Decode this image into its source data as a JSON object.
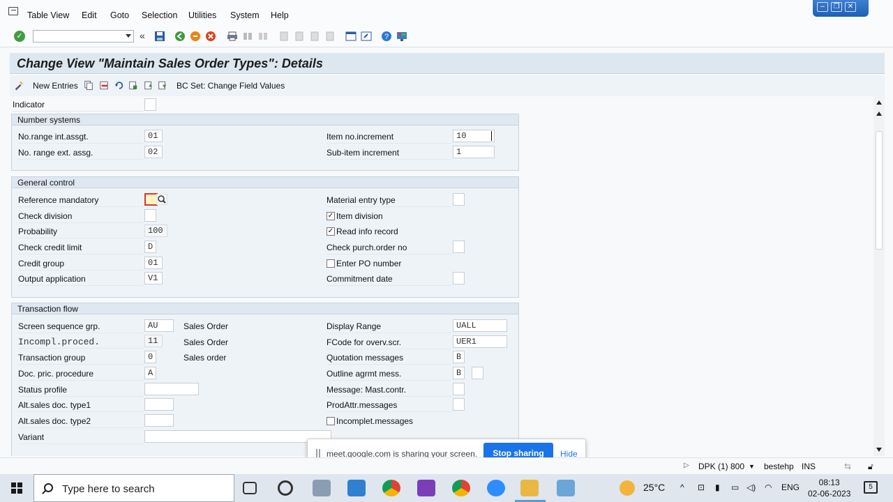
{
  "menu": [
    "Table View",
    "Edit",
    "Goto",
    "Selection",
    "Utilities",
    "System",
    "Help"
  ],
  "page": {
    "title": "Change View \"Maintain Sales Order Types\": Details"
  },
  "appbar": {
    "new_entries": "New Entries",
    "bc_set": "BC Set: Change Field Values"
  },
  "indicator_label": "Indicator",
  "number_systems": {
    "title": "Number systems",
    "no_range_int_label": "No.range int.assgt.",
    "no_range_int_value": "01",
    "no_range_ext_label": "No. range ext. assg.",
    "no_range_ext_value": "02",
    "item_no_inc_label": "Item no.increment",
    "item_no_inc_value": "10",
    "sub_item_inc_label": "Sub-item increment",
    "sub_item_inc_value": "1"
  },
  "general_control": {
    "title": "General control",
    "reference_mandatory_label": "Reference mandatory",
    "check_division_label": "Check division",
    "probability_label": "Probability",
    "probability_value": "100",
    "check_credit_limit_label": "Check credit limit",
    "check_credit_limit_value": "D",
    "credit_group_label": "Credit group",
    "credit_group_value": "01",
    "output_application_label": "Output application",
    "output_application_value": "V1",
    "material_entry_type_label": "Material entry type",
    "item_division_label": "Item division",
    "read_info_record_label": "Read info record",
    "check_purch_order_label": "Check purch.order no",
    "enter_po_number_label": "Enter PO number",
    "commitment_date_label": "Commitment  date"
  },
  "transaction_flow": {
    "title": "Transaction flow",
    "screen_seq_label": "Screen sequence grp.",
    "screen_seq_value": "AU",
    "screen_seq_text": "Sales Order",
    "incompl_label": "Incompl.proced.",
    "incompl_value": "11",
    "incompl_text": "Sales Order",
    "transaction_group_label": "Transaction group",
    "transaction_group_value": "0",
    "transaction_group_text": "Sales order",
    "doc_pric_label": "Doc. pric. procedure",
    "doc_pric_value": "A",
    "status_profile_label": "Status profile",
    "alt_type1_label": "Alt.sales doc. type1",
    "alt_type2_label": "Alt.sales doc. type2",
    "variant_label": "Variant",
    "display_range_label": "Display Range",
    "display_range_value": "UALL",
    "fcode_label": "FCode for overv.scr.",
    "fcode_value": "UER1",
    "quotation_msgs_label": "Quotation messages",
    "quotation_msgs_value": "B",
    "outline_agrmt_label": "Outline agrmt mess.",
    "outline_agrmt_value": "B",
    "message_mast_label": "Message: Mast.contr.",
    "prodattr_label": "ProdAttr.messages",
    "incomplet_msgs_label": "Incomplet.messages"
  },
  "share": {
    "message": "meet.google.com is sharing your screen.",
    "stop": "Stop sharing",
    "hide": "Hide"
  },
  "status": {
    "system": "DPK (1) 800",
    "user": "bestehp",
    "mode": "INS"
  },
  "taskbar": {
    "search_placeholder": "Type here to search",
    "weather": "25°C",
    "language": "ENG",
    "time": "08:13",
    "date": "02-06-2023",
    "notifications": "5"
  }
}
